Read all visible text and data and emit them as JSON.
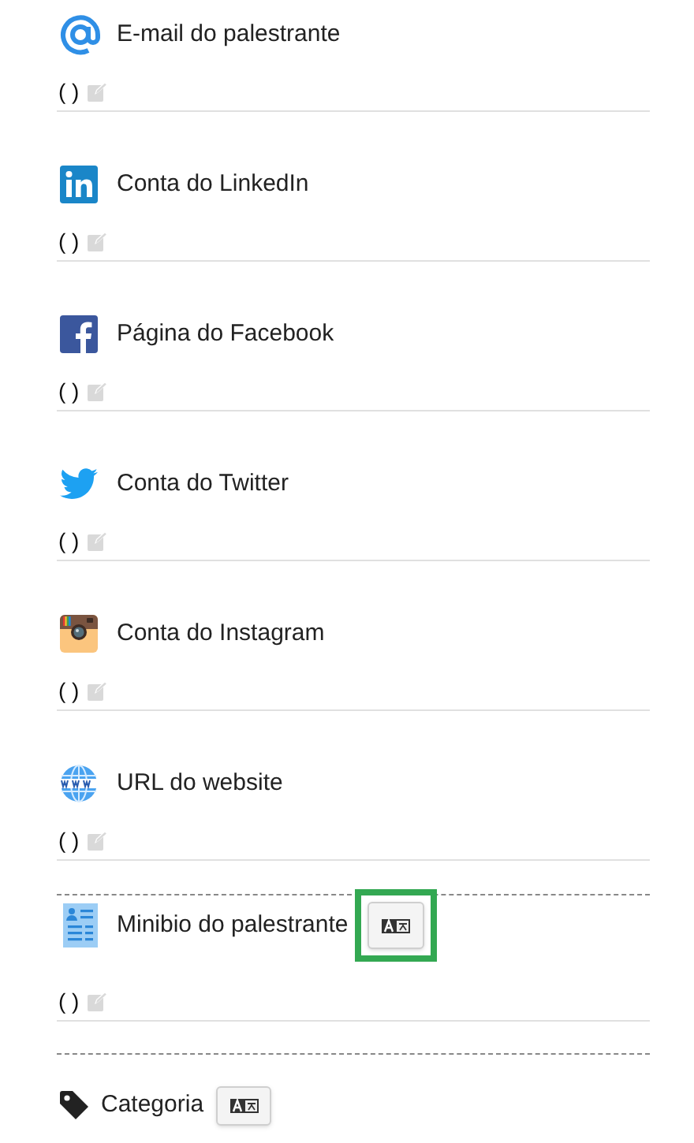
{
  "fields": [
    {
      "kind": "email",
      "label": "E-mail do palestrante",
      "value": "( )"
    },
    {
      "kind": "linkedin",
      "label": "Conta do LinkedIn",
      "value": "( )"
    },
    {
      "kind": "facebook",
      "label": "Página do Facebook",
      "value": "( )"
    },
    {
      "kind": "twitter",
      "label": "Conta do Twitter",
      "value": "( )"
    },
    {
      "kind": "instagram",
      "label": "Conta do Instagram",
      "value": "( )"
    },
    {
      "kind": "website",
      "label": "URL do website",
      "value": "( )"
    }
  ],
  "minibio": {
    "label": "Minibio do palestrante",
    "value": "( )",
    "translate_highlighted": true
  },
  "category": {
    "label": "Categoria",
    "translate_highlighted": false
  }
}
